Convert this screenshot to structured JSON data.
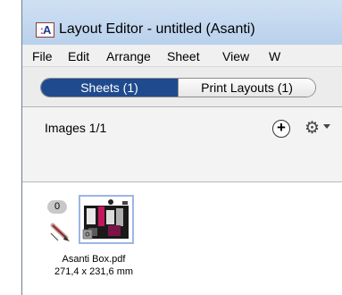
{
  "window": {
    "app_icon_text": "A",
    "title": "Layout Editor - untitled (Asanti)"
  },
  "menu": [
    "File",
    "Edit",
    "Arrange",
    "Sheet",
    "View",
    "W"
  ],
  "tabs": [
    {
      "label": "Sheets (1)",
      "active": true
    },
    {
      "label": "Print Layouts (1)",
      "active": false
    }
  ],
  "images_panel": {
    "label": "Images 1/1",
    "add_icon": "plus-circle-icon",
    "settings_icon": "gear-icon"
  },
  "image_item": {
    "badge": "0",
    "name": "Asanti Box.pdf",
    "size": "271,4 x 231,6 mm",
    "edit_icon": "pen-icon"
  },
  "colors": {
    "active_tab": "#1f4a8e",
    "thumbnail_border": "#9cb6e4",
    "titlebar": "#c4d9f0"
  }
}
